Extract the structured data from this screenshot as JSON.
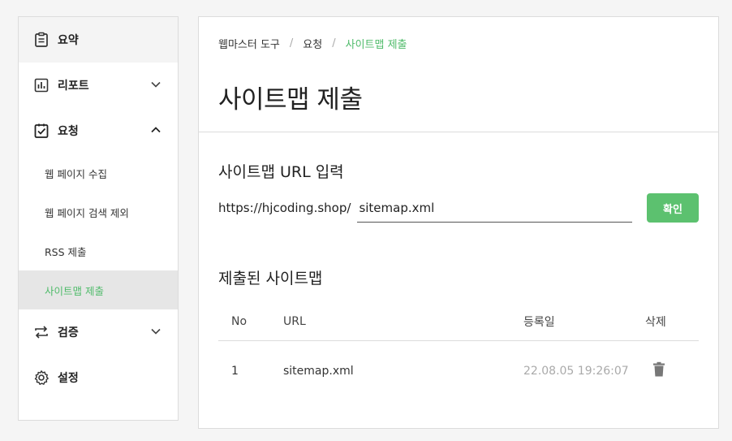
{
  "sidebar": {
    "items": [
      {
        "label": "요약",
        "icon": "clipboard-icon"
      },
      {
        "label": "리포트",
        "icon": "chart-icon"
      },
      {
        "label": "요청",
        "icon": "clipboard-check-icon"
      },
      {
        "label": "검증",
        "icon": "repeat-icon"
      },
      {
        "label": "설정",
        "icon": "gear-icon"
      }
    ],
    "sub_items": [
      "웹 페이지 수집",
      "웹 페이지 검색 제외",
      "RSS 제출",
      "사이트맵 제출"
    ]
  },
  "breadcrumb": [
    "웹마스터 도구",
    "요청",
    "사이트맵 제출"
  ],
  "page_title": "사이트맵 제출",
  "url_section": {
    "title": "사이트맵 URL 입력",
    "prefix": "https://hjcoding.shop/",
    "input_value": "sitemap.xml",
    "confirm_label": "확인"
  },
  "submitted": {
    "title": "제출된 사이트맵",
    "headers": [
      "No",
      "URL",
      "등록일",
      "삭제"
    ],
    "rows": [
      {
        "no": "1",
        "url": "sitemap.xml",
        "date": "22.08.05 19:26:07"
      }
    ]
  },
  "colors": {
    "accent": "#4fbb6a",
    "button": "#5cc16f"
  }
}
